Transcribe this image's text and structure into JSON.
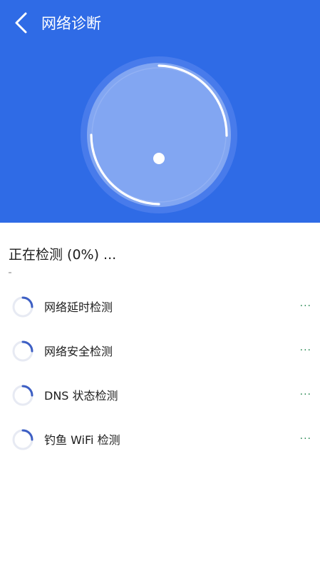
{
  "header": {
    "title": "网络诊断",
    "background_color": "#2f6be6",
    "back_icon": "chevron-left-icon"
  },
  "dial": {
    "progress_percent": 0,
    "ring_color": "#ffffff",
    "inner_fill": "#7a9ff0"
  },
  "status": {
    "text": "正在检测 (0%) ...",
    "progress_percent": 0
  },
  "checks": [
    {
      "label": "网络延时检测",
      "status": "···",
      "spinner_icon": "loading-spinner-icon"
    },
    {
      "label": "网络安全检测",
      "status": "···",
      "spinner_icon": "loading-spinner-icon"
    },
    {
      "label": "DNS 状态检测",
      "status": "···",
      "spinner_icon": "loading-spinner-icon"
    },
    {
      "label": "钓鱼 WiFi 检测",
      "status": "···",
      "spinner_icon": "loading-spinner-icon"
    }
  ],
  "colors": {
    "accent": "#2f6be6",
    "spinner": "#3d5fc4",
    "status_dots": "#2e8b57"
  }
}
